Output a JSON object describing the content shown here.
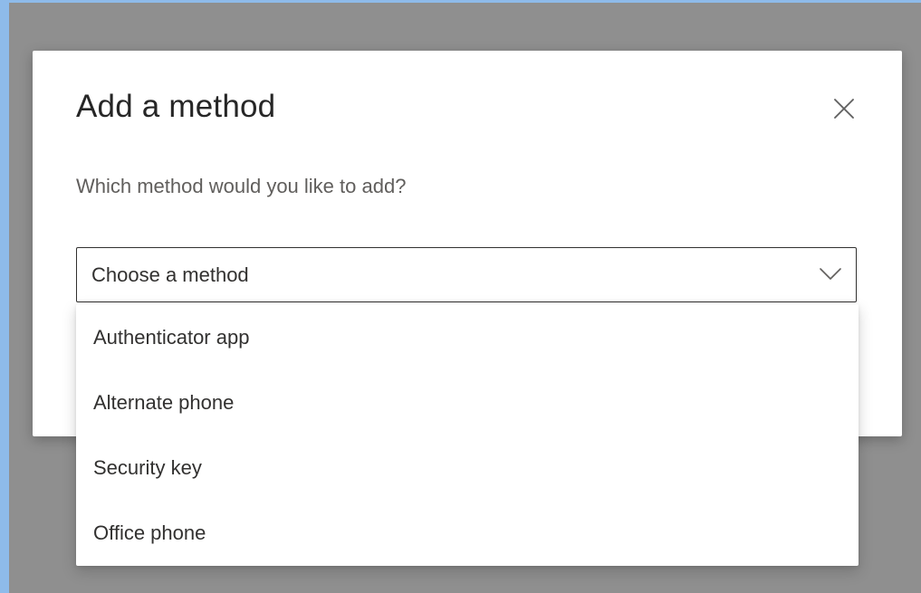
{
  "dialog": {
    "title": "Add a method",
    "prompt": "Which method would you like to add?",
    "close_icon": "close-icon"
  },
  "method_select": {
    "value": "Choose a method",
    "icon": "chevron-down-icon",
    "options": [
      {
        "label": "Authenticator app"
      },
      {
        "label": "Alternate phone"
      },
      {
        "label": "Security key"
      },
      {
        "label": "Office phone"
      }
    ]
  },
  "colors": {
    "overlay": "#8f8f8f",
    "background_edge": "#8ebbea",
    "text_primary": "#262626",
    "text_secondary": "#605e5c",
    "border": "#323130"
  }
}
